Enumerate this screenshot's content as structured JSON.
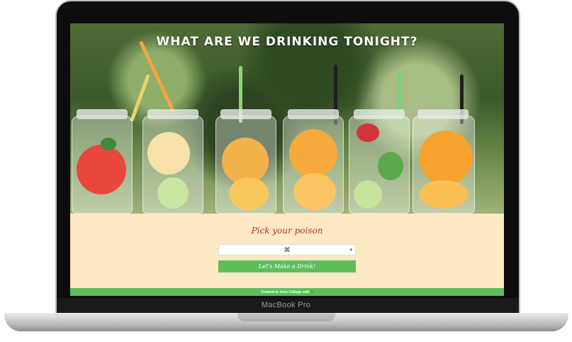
{
  "device": {
    "brand_label": "MacBook Pro"
  },
  "hero": {
    "title": "WHAT ARE WE DRINKING TONIGHT?"
  },
  "form": {
    "heading": "Pick your poison",
    "select_value": "⌘",
    "button_label": "Let's Make a Drink!"
  },
  "footer": {
    "text": "Created at Juno College with",
    "heart_icon": "heart-icon"
  },
  "colors": {
    "cream": "#fde9c4",
    "green": "#5cbf5a",
    "heading_red": "#b3342c"
  }
}
